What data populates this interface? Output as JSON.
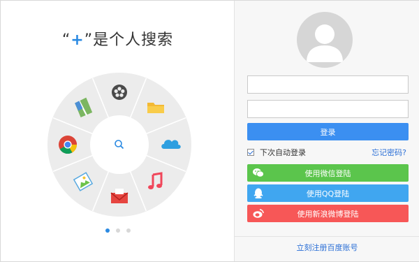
{
  "headline": {
    "quote_open": "“",
    "plus": "+",
    "quote_close": "”",
    "text": "是个人搜索"
  },
  "wheel": {
    "center_icon": "search-icon",
    "apps": [
      {
        "icon": "film-reel-icon",
        "name": "video"
      },
      {
        "icon": "folder-icon",
        "name": "files"
      },
      {
        "icon": "cloud-icon",
        "name": "cloud"
      },
      {
        "icon": "music-note-icon",
        "name": "music"
      },
      {
        "icon": "mail-icon",
        "name": "mail"
      },
      {
        "icon": "picture-icon",
        "name": "photos"
      },
      {
        "icon": "chrome-icon",
        "name": "browser"
      },
      {
        "icon": "map-icon",
        "name": "maps"
      }
    ]
  },
  "pager": {
    "count": 3,
    "active": 0
  },
  "login": {
    "username": {
      "value": "",
      "placeholder": ""
    },
    "password": {
      "value": "",
      "placeholder": ""
    },
    "login_button": "登录",
    "remember_label": "下次自动登录",
    "remember_checked": true,
    "forgot_link": "忘记密码?",
    "wechat_button": "使用微信登陆",
    "qq_button": "使用QQ登陆",
    "weibo_button": "使用新浪微博登陆",
    "register_link": "立刻注册百度账号"
  },
  "colors": {
    "accent": "#2b8ae2",
    "login": "#3b8ff1",
    "wechat": "#5bc54c",
    "qq": "#40a6f0",
    "weibo": "#f75757",
    "link": "#2b6fd6"
  }
}
